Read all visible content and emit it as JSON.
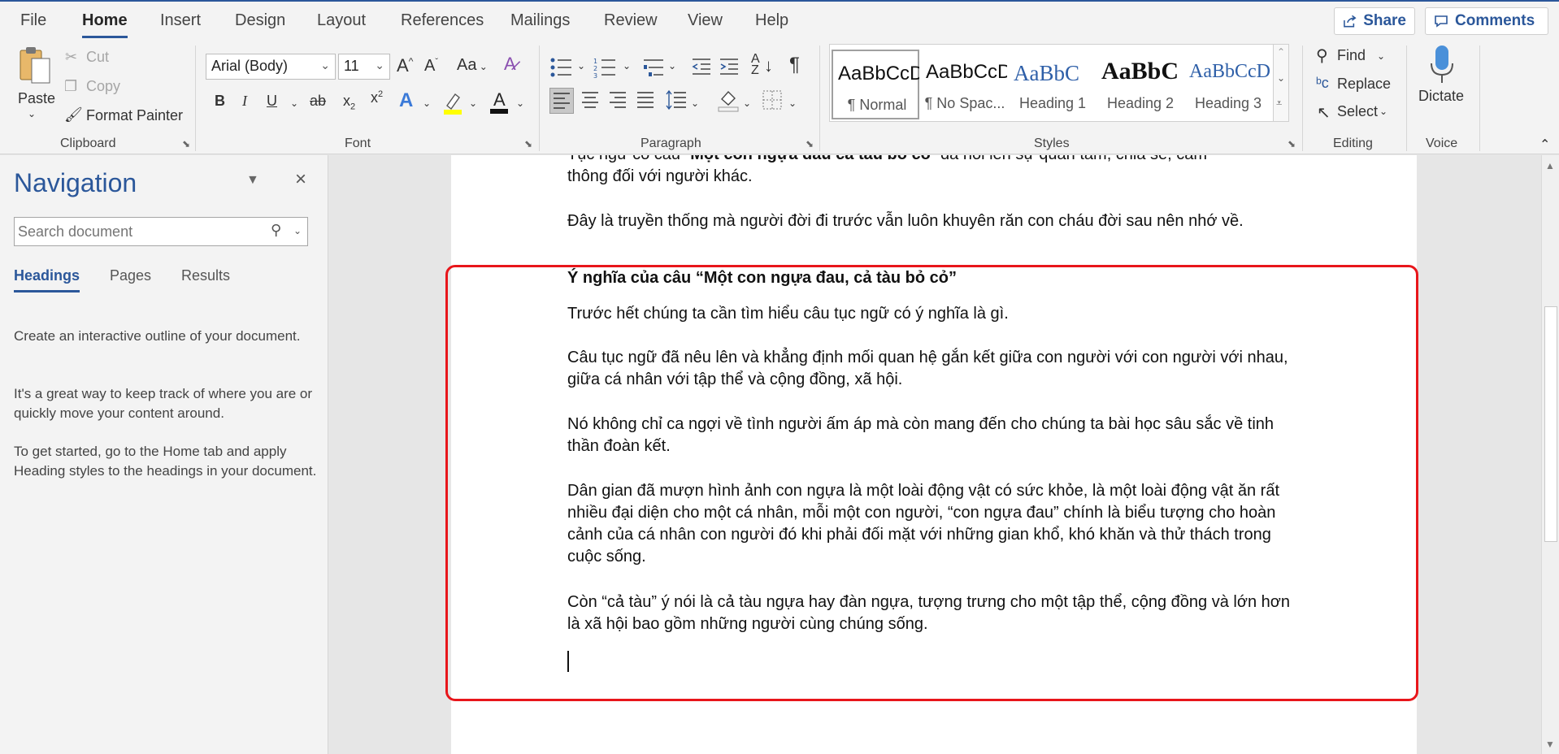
{
  "menu": {
    "tabs": [
      "File",
      "Home",
      "Insert",
      "Design",
      "Layout",
      "References",
      "Mailings",
      "Review",
      "View",
      "Help"
    ],
    "share_label": "Share",
    "comments_label": "Comments"
  },
  "ribbon": {
    "clipboard": {
      "paste": "Paste",
      "cut": "Cut",
      "copy": "Copy",
      "format_painter": "Format Painter",
      "label": "Clipboard"
    },
    "font": {
      "name": "Arial (Body)",
      "size": "11",
      "change_case": "Aa",
      "label": "Font"
    },
    "paragraph": {
      "label": "Paragraph"
    },
    "styles": {
      "label": "Styles",
      "items": [
        {
          "sample": "AaBbCcDc",
          "name": "¶ Normal"
        },
        {
          "sample": "AaBbCcDc",
          "name": "¶ No Spac..."
        },
        {
          "sample": "AaBbC",
          "name": "Heading 1"
        },
        {
          "sample": "AaBbC",
          "name": "Heading 2"
        },
        {
          "sample": "AaBbCcD",
          "name": "Heading 3"
        }
      ]
    },
    "editing": {
      "find": "Find",
      "replace": "Replace",
      "select": "Select",
      "label": "Editing"
    },
    "voice": {
      "dictate": "Dictate",
      "label": "Voice"
    }
  },
  "navigation": {
    "title": "Navigation",
    "search_placeholder": "Search document",
    "tabs": [
      "Headings",
      "Pages",
      "Results"
    ],
    "paragraphs": [
      "Create an interactive outline of your document.",
      "It's a great way to keep track of where you are or quickly move your content around.",
      "To get started, go to the Home tab and apply Heading styles to the headings in your document."
    ]
  },
  "document": {
    "top_line_prefix": "Tục ngữ có câu “",
    "top_line_bold": "Một con ngựa đau cả tàu bỏ cỏ",
    "top_line_suffix": "” đã nói lên sự quan tâm, chia sẻ, cảm",
    "top_line_2": "thông đối với người khác.",
    "p_tradition": "Đây là truyền thống mà người đời đi trước vẫn luôn khuyên răn con cháu đời sau nên nhớ về.",
    "heading": "Ý nghĩa của câu “Một con ngựa đau, cả tàu bỏ cỏ”",
    "p1": "Trước hết chúng ta cần tìm hiểu câu tục ngữ có ý nghĩa là gì.",
    "p2": "Câu tục ngữ đã nêu lên và khẳng định mối quan hệ gắn kết giữa con người với con người với nhau, giữa cá nhân với tập thể và cộng đồng, xã hội.",
    "p3": "Nó không chỉ ca ngợi về tình người ấm áp mà còn mang đến cho chúng ta bài học sâu sắc về tinh thần đoàn kết.",
    "p4": "Dân gian đã mượn hình ảnh con ngựa là một loài động vật có sức khỏe, là một loài động vật ăn rất nhiều đại diện cho một cá nhân, mỗi một con người, “con ngựa đau” chính là biểu tượng cho hoàn cảnh của cá nhân con người đó khi phải đối mặt với những gian khổ, khó khăn và thử thách trong cuộc sống.",
    "p5": "Còn “cả tàu” ý nói là cả tàu ngựa hay đàn ngựa, tượng trưng cho một tập thể, cộng đồng và lớn hơn là xã hội bao gồm những người cùng chúng sống."
  },
  "colors": {
    "accent": "#2b579a",
    "highlight": "#e8161b"
  }
}
